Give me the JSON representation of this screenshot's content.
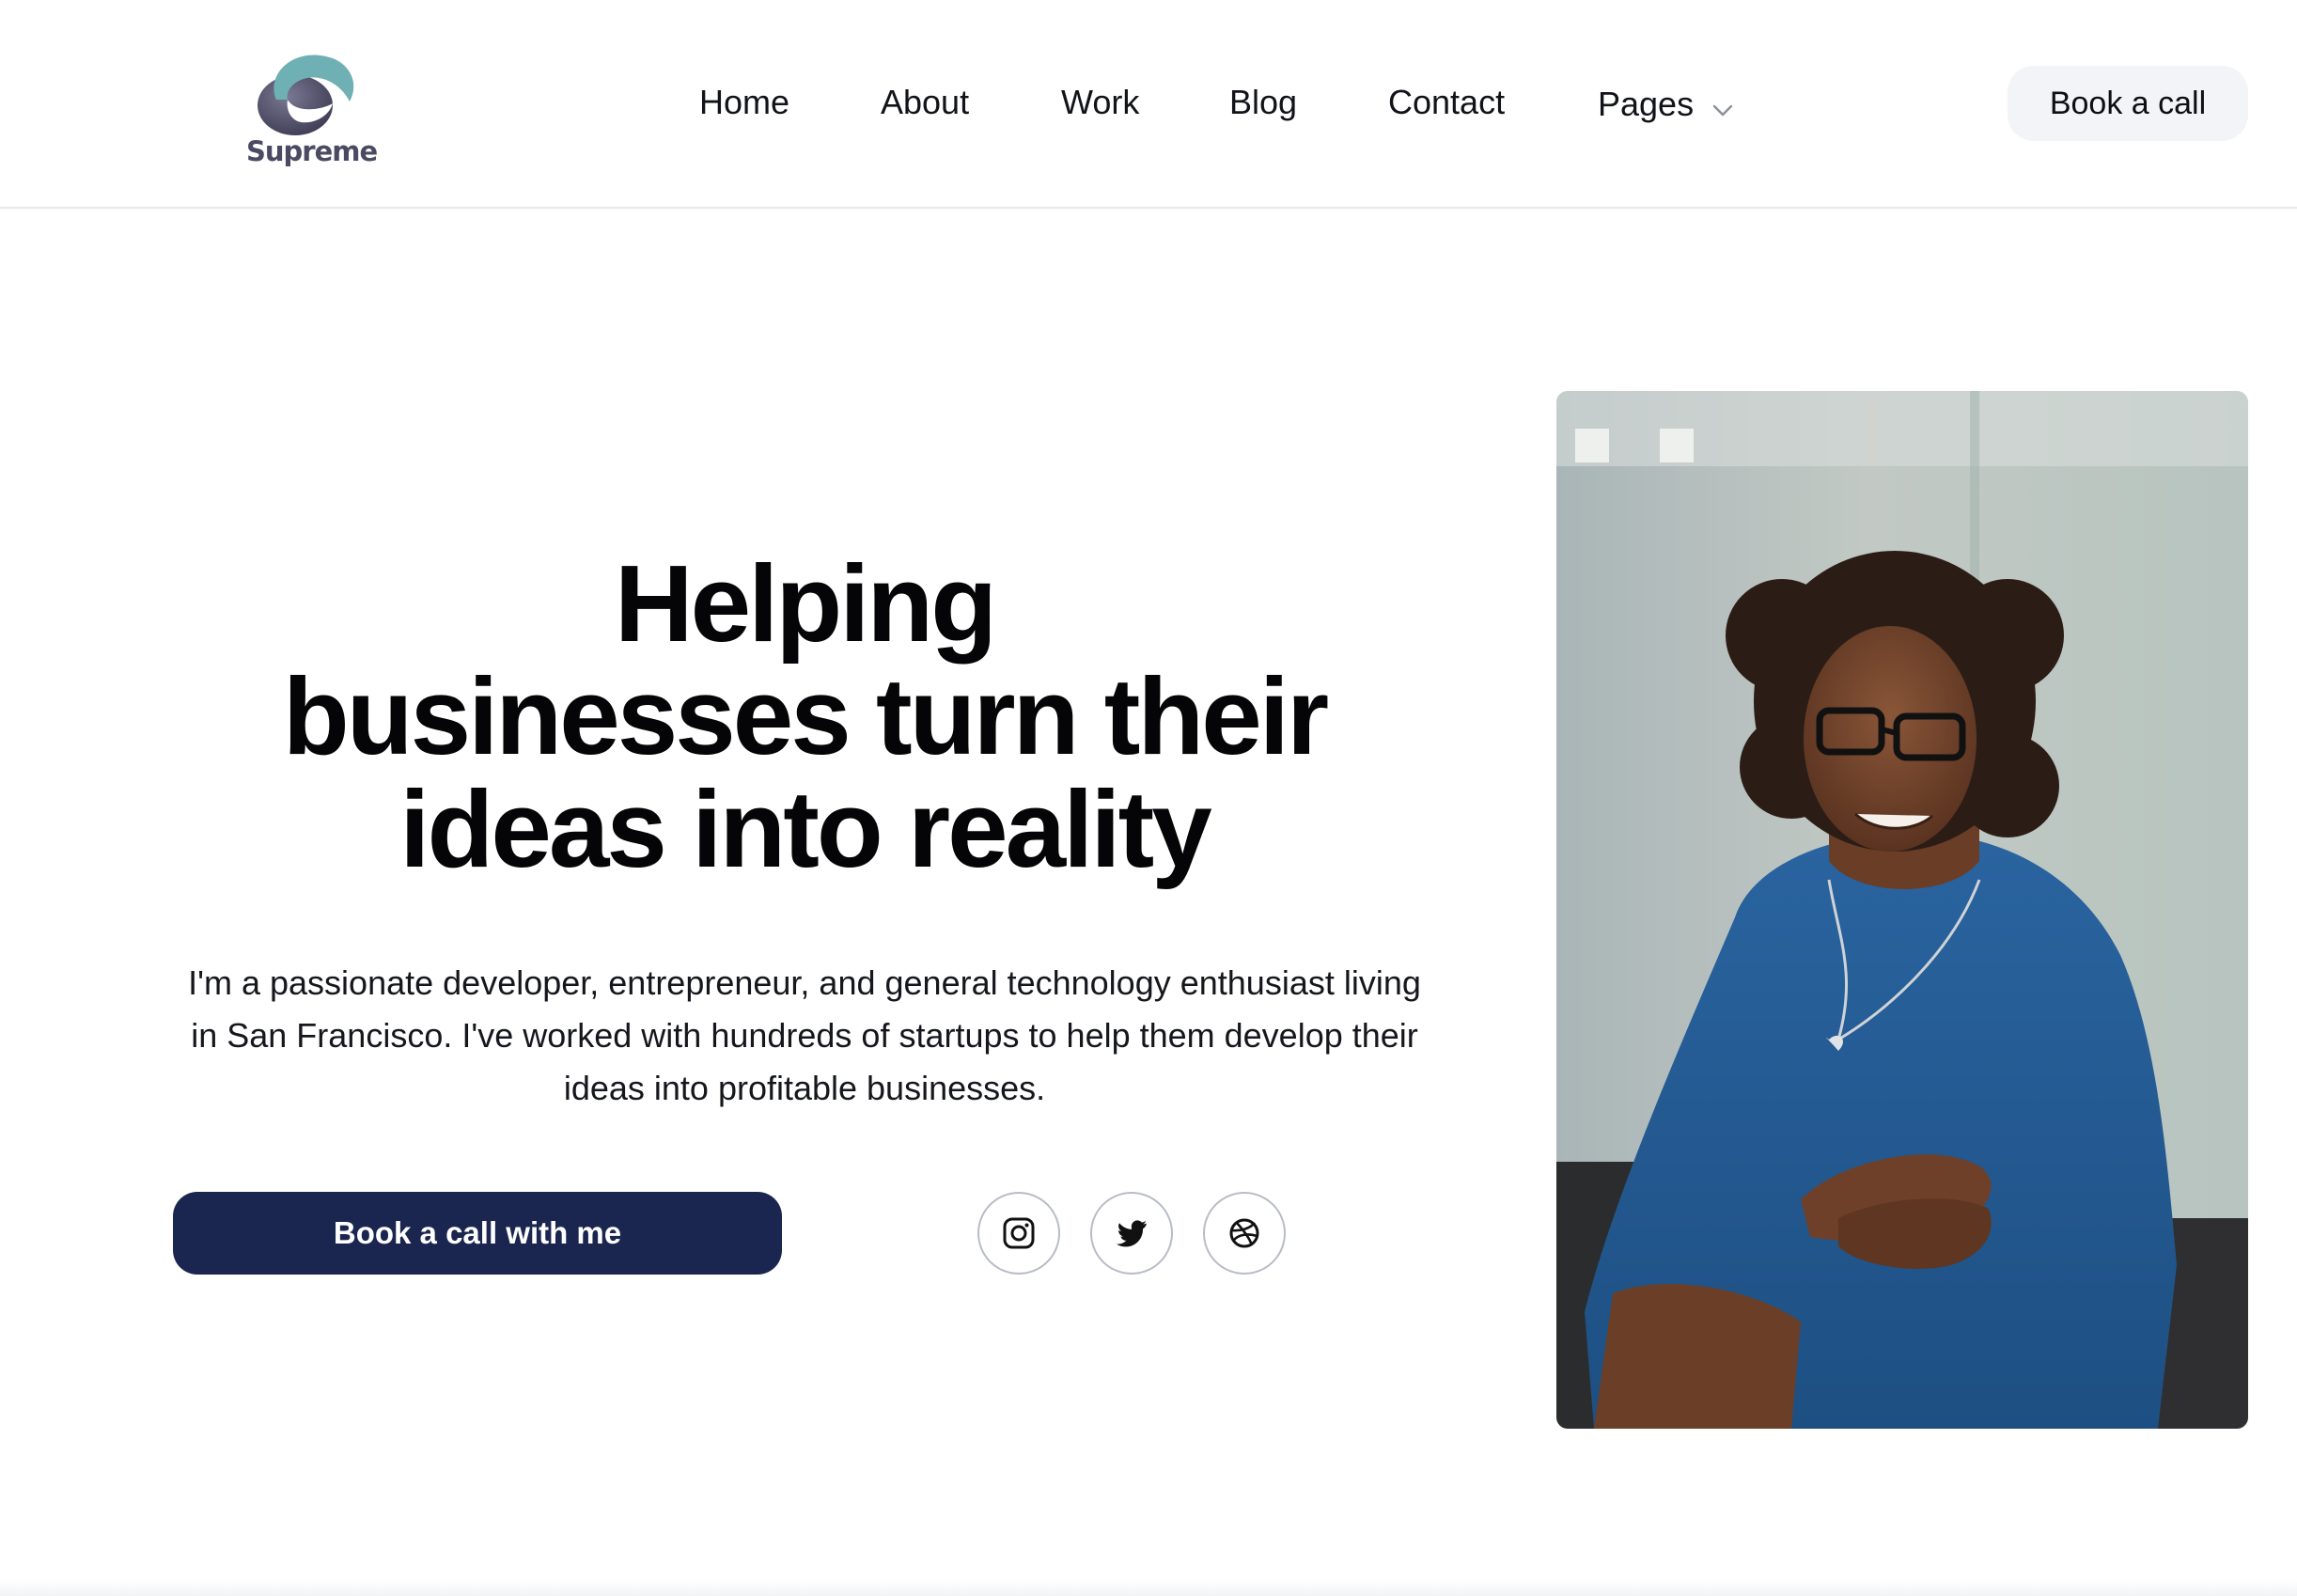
{
  "brand": {
    "name": "Supreme"
  },
  "nav": {
    "items": [
      {
        "label": "Home"
      },
      {
        "label": "About"
      },
      {
        "label": "Work"
      },
      {
        "label": "Blog"
      },
      {
        "label": "Contact"
      },
      {
        "label": "Pages"
      }
    ],
    "book_label": "Book a call"
  },
  "hero": {
    "title_line1": "Helping",
    "title_line2": "businesses turn their",
    "title_line3": "ideas into reality",
    "description": "I'm a passionate developer, entrepreneur, and general technology enthusiast living in San Francisco. I've worked with hundreds of startups to help them develop their ideas into profitable businesses.",
    "cta_label": "Book a call with me"
  },
  "social": {
    "icons": [
      "instagram-icon",
      "twitter-icon",
      "dribbble-icon"
    ]
  },
  "colors": {
    "cta_background": "#1b2650",
    "nav_button_background": "#f2f4f7",
    "logo_teal": "#6fb0b5",
    "logo_purple": "#4a4a63"
  }
}
